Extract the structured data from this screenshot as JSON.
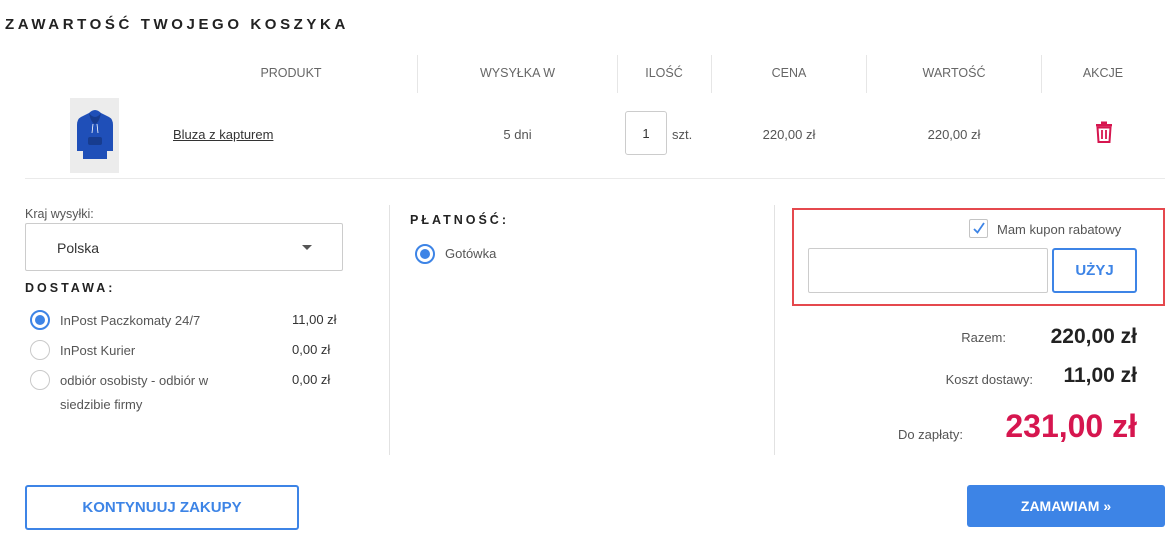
{
  "page": {
    "title": "ZAWARTOŚĆ TWOJEGO KOSZYKA"
  },
  "table": {
    "headers": [
      "PRODUKT",
      "WYSYŁKA W",
      "ILOŚĆ",
      "CENA",
      "WARTOŚĆ",
      "AKCJE"
    ],
    "rows": [
      {
        "name": "Bluza z kapturem",
        "shipping": "5 dni",
        "quantity": "1",
        "unit": "szt.",
        "price": "220,00 zł",
        "value": "220,00 zł",
        "action_icon": "trash-icon"
      }
    ]
  },
  "shipping": {
    "country_label": "Kraj wysyłki:",
    "country_value": "Polska"
  },
  "delivery": {
    "title": "DOSTAWA:",
    "options": [
      {
        "label": "InPost Paczkomaty 24/7",
        "price": "11,00 zł",
        "selected": true
      },
      {
        "label": "InPost Kurier",
        "price": "0,00 zł",
        "selected": false
      },
      {
        "label": "odbiór osobisty - odbiór w siedzibie firmy",
        "price": "0,00 zł",
        "selected": false
      }
    ]
  },
  "payment": {
    "title": "PŁATNOŚĆ:",
    "options": [
      {
        "label": "Gotówka",
        "selected": true
      }
    ]
  },
  "coupon": {
    "checkbox_label": "Mam kupon rabatowy",
    "checked": true,
    "input_value": "",
    "apply_label": "UŻYJ"
  },
  "totals": {
    "subtotal_label": "Razem:",
    "subtotal_value": "220,00 zł",
    "shipping_label": "Koszt dostawy:",
    "shipping_value": "11,00 zł",
    "total_label": "Do zapłaty:",
    "total_value": "231,00 zł"
  },
  "actions": {
    "continue_label": "KONTYNUUJ ZAKUPY",
    "order_label": "ZAMAWIAM »"
  },
  "colors": {
    "accent": "#3d84e6",
    "total": "#d6164f",
    "highlight_border": "#e5484d"
  }
}
